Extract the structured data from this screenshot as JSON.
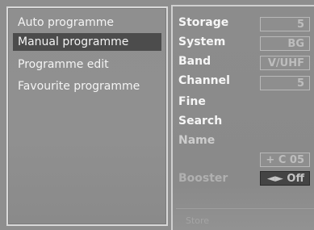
{
  "menu": {
    "items": [
      {
        "label": "Auto programme"
      },
      {
        "label": "Manual programme"
      },
      {
        "label": "Programme edit"
      },
      {
        "label": "Favourite programme"
      }
    ],
    "selected_index": 1
  },
  "settings": {
    "storage": {
      "label": "Storage",
      "value": "5"
    },
    "system": {
      "label": "System",
      "value": "BG"
    },
    "band": {
      "label": "Band",
      "value": "V/UHF"
    },
    "channel": {
      "label": "Channel",
      "value": "5"
    },
    "fine": {
      "label": "Fine"
    },
    "search": {
      "label": "Search"
    },
    "name": {
      "label": "Name",
      "value": "+ C 05"
    },
    "booster": {
      "label": "Booster",
      "value": "◄► Off"
    }
  },
  "footer": {
    "hint": "Store"
  }
}
